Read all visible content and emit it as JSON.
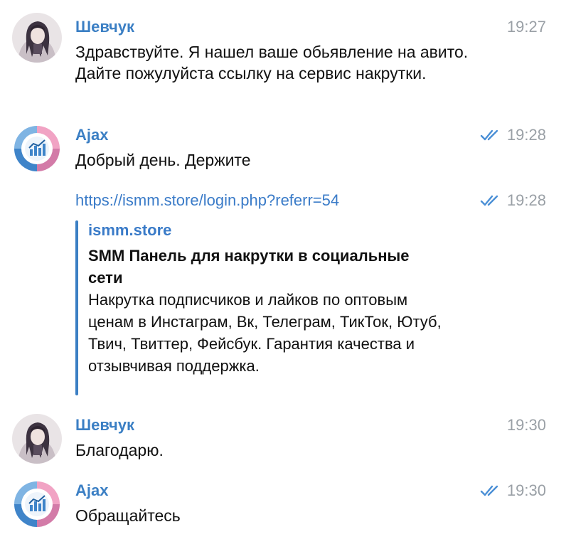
{
  "colors": {
    "sender_shevchuk": "#3b7fc4",
    "sender_ajax": "#3b7fc4",
    "time": "#9aa0a6",
    "read_check": "#4a8fd6",
    "link": "#3a7bc8",
    "preview_bar": "#3b7fc4"
  },
  "messages": [
    {
      "sender": "Шевчук",
      "time": "19:27",
      "avatar_icon": "user-photo-avatar",
      "text": "Здравствуйте. Я нашел ваше обьявление на авито. Дайте пожулуйста ссылку на сервис накрутки."
    },
    {
      "sender": "Ajax",
      "time": "19:28",
      "avatar_icon": "analytics-chart-avatar",
      "read_icon": "double-check-icon",
      "text": "Добрый день. Держите"
    },
    {
      "time": "19:28",
      "read_icon": "double-check-icon",
      "link": "https://ismm.store/login.php?referr=54",
      "preview": {
        "site": "ismm.store",
        "title": "SMM Панель для накрутки в социальные сети",
        "description": "Накрутка подписчиков и лайков по оптовым ценам в Инстаграм, Вк, Телеграм, ТикТок, Ютуб, Твич, Твиттер, Фейсбук. Гарантия качества и отзывчивая поддержка."
      }
    },
    {
      "sender": "Шевчук",
      "time": "19:30",
      "avatar_icon": "user-photo-avatar",
      "text": "Благодарю."
    },
    {
      "sender": "Ajax",
      "time": "19:30",
      "avatar_icon": "analytics-chart-avatar",
      "read_icon": "double-check-icon",
      "text": "Обращайтесь"
    }
  ]
}
